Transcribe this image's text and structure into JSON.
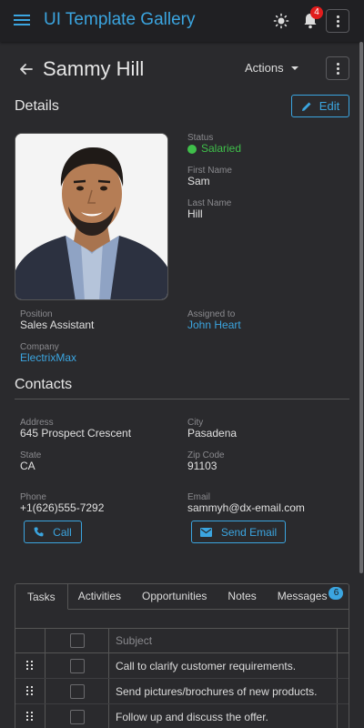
{
  "header": {
    "app_title": "UI Template Gallery",
    "notification_count": "4",
    "icons": [
      "menu-icon",
      "sun-icon",
      "bell-icon",
      "more-vertical-icon"
    ]
  },
  "profile": {
    "name": "Sammy Hill",
    "actions_label": "Actions"
  },
  "details": {
    "section_title": "Details",
    "edit_label": "Edit",
    "status_label": "Status",
    "status_value": "Salaried",
    "first_name_label": "First Name",
    "first_name": "Sam",
    "last_name_label": "Last Name",
    "last_name": "Hill",
    "position_label": "Position",
    "position": "Sales Assistant",
    "assigned_label": "Assigned to",
    "assigned_to": "John Heart",
    "company_label": "Company",
    "company": "ElectrixMax"
  },
  "contacts": {
    "section_title": "Contacts",
    "address_label": "Address",
    "address": "645 Prospect Crescent",
    "city_label": "City",
    "city": "Pasadena",
    "state_label": "State",
    "state": "CA",
    "zip_label": "Zip Code",
    "zip": "91103",
    "phone_label": "Phone",
    "phone": "+1(626)555-7292",
    "email_label": "Email",
    "email": "sammyh@dx-email.com",
    "call_label": "Call",
    "send_email_label": "Send Email"
  },
  "tabs": {
    "items": [
      "Tasks",
      "Activities",
      "Opportunities",
      "Notes",
      "Messages"
    ],
    "messages_badge": "6",
    "active": "Tasks"
  },
  "tasks_grid": {
    "subject_header": "Subject",
    "rows": [
      "Call to clarify customer requirements.",
      "Send pictures/brochures of new products.",
      "Follow up and discuss the offer."
    ]
  },
  "colors": {
    "accent": "#3ba5e0",
    "status_green": "#3fbf4a",
    "badge_red": "#e21d1d",
    "background": "#2a2a2d"
  }
}
